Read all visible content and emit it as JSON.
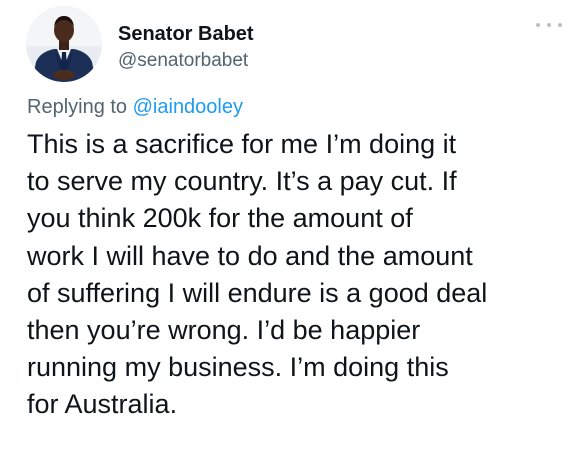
{
  "author": {
    "display_name": "Senator Babet",
    "handle": "@senatorbabet"
  },
  "reply": {
    "prefix": "Replying to",
    "mention": "@iaindooley"
  },
  "tweet": {
    "lines": [
      "This is a sacrifice for me I’m doing it",
      "to serve my country. It’s a pay cut. If",
      "you think 200k for the amount of",
      "work I will have to do and the amount",
      "of suffering I will endure is a good deal",
      "then you’re wrong. I’d be happier",
      "running my business. I’m doing this",
      "for Australia."
    ]
  },
  "icons": {
    "more": "more-horizontal-icon",
    "avatar": "profile-photo"
  },
  "colors": {
    "text": "#0f1419",
    "secondary": "#536471",
    "link": "#1d9bf0"
  }
}
